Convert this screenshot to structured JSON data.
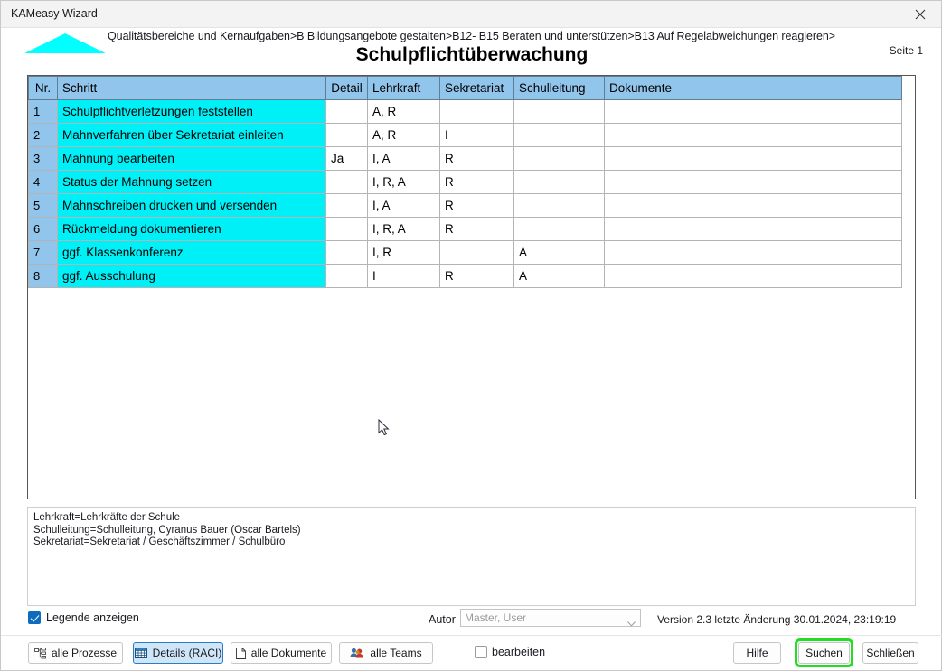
{
  "window": {
    "title": "KAMeasy Wizard",
    "close_icon": "close-icon"
  },
  "header": {
    "logo_icon": "triangle-logo-icon",
    "breadcrumb": "Qualitätsbereiche und Kernaufgaben>B Bildungsangebote gestalten>B12- B15 Beraten und unterstützen>B13 Auf Regelabweichungen reagieren>",
    "title": "Schulpflichtüberwachung",
    "page_label": "Seite 1"
  },
  "table": {
    "columns": [
      "Nr.",
      "Schritt",
      "Detail",
      "Lehrkraft",
      "Sekretariat",
      "Schulleitung",
      "Dokumente"
    ],
    "rows": [
      {
        "nr": "1",
        "schritt": "Schulpflichtverletzungen feststellen",
        "detail": "",
        "lehrkraft": "A, R",
        "sekretariat": "",
        "schulleitung": "",
        "dokumente": ""
      },
      {
        "nr": "2",
        "schritt": "Mahnverfahren über Sekretariat einleiten",
        "detail": "",
        "lehrkraft": "A, R",
        "sekretariat": "I",
        "schulleitung": "",
        "dokumente": ""
      },
      {
        "nr": "3",
        "schritt": "Mahnung bearbeiten",
        "detail": "Ja",
        "lehrkraft": "I, A",
        "sekretariat": "R",
        "schulleitung": "",
        "dokumente": ""
      },
      {
        "nr": "4",
        "schritt": "Status der Mahnung setzen",
        "detail": "",
        "lehrkraft": "I, R, A",
        "sekretariat": "R",
        "schulleitung": "",
        "dokumente": ""
      },
      {
        "nr": "5",
        "schritt": "Mahnschreiben drucken und versenden",
        "detail": "",
        "lehrkraft": "I, A",
        "sekretariat": "R",
        "schulleitung": "",
        "dokumente": ""
      },
      {
        "nr": "6",
        "schritt": "Rückmeldung dokumentieren",
        "detail": "",
        "lehrkraft": "I, R, A",
        "sekretariat": "R",
        "schulleitung": "",
        "dokumente": ""
      },
      {
        "nr": "7",
        "schritt": "ggf. Klassenkonferenz",
        "detail": "",
        "lehrkraft": "I, R",
        "sekretariat": "",
        "schulleitung": "A",
        "dokumente": ""
      },
      {
        "nr": "8",
        "schritt": "ggf. Ausschulung",
        "detail": "",
        "lehrkraft": "I",
        "sekretariat": "R",
        "schulleitung": "A",
        "dokumente": ""
      }
    ]
  },
  "legend": {
    "lines": [
      "Lehrkraft=Lehrkräfte der Schule",
      "Schulleitung=Schulleitung, Cyranus Bauer (Oscar Bartels)",
      "Sekretariat=Sekretariat / Geschäftszimmer / Schulbüro"
    ]
  },
  "controls": {
    "legend_checkbox_label": "Legende anzeigen",
    "legend_checkbox_checked": true,
    "autor_label": "Autor",
    "autor_value": "Master, User",
    "version_info": "Version 2.3   letzte Änderung 30.01.2024, 23:19:19",
    "edit_checkbox_label": "bearbeiten",
    "edit_checkbox_checked": false
  },
  "buttons": {
    "all_processes": "alle Prozesse",
    "details_raci": "Details (RACI)",
    "all_documents": "alle Dokumente",
    "all_teams": "alle Teams",
    "help": "Hilfe",
    "search": "Suchen",
    "close": "Schließen"
  },
  "colors": {
    "header_row": "#92c5ec",
    "step_cell": "#00f0f8",
    "accent": "#0f6cbd",
    "focus_ring": "#22dd22"
  }
}
